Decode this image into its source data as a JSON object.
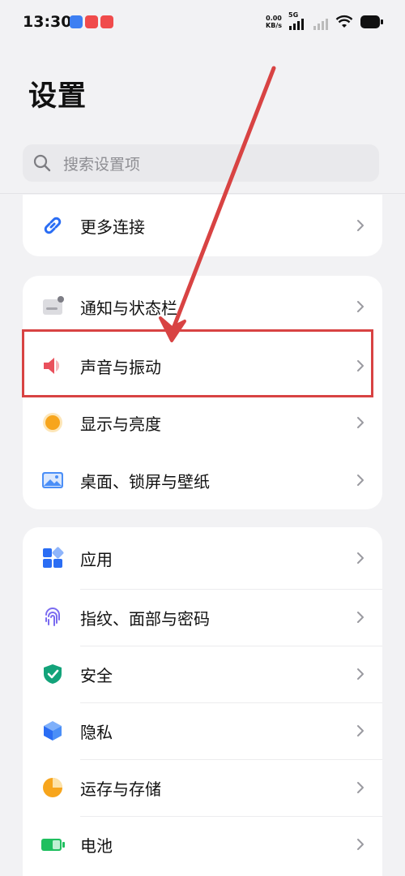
{
  "status_bar": {
    "time": "13:30",
    "net_speed_value": "0.00",
    "net_speed_unit": "KB/s",
    "network_type": "5G",
    "app_badge_colors": [
      "#3d7ff2",
      "#f04b4b",
      "#f04b4b"
    ]
  },
  "page": {
    "title": "设置"
  },
  "search": {
    "placeholder": "搜索设置项"
  },
  "group_top": {
    "items": [
      {
        "label": "更多连接",
        "icon": "link-icon"
      }
    ]
  },
  "group_display": {
    "items": [
      {
        "label": "通知与状态栏",
        "icon": "notification-icon"
      },
      {
        "label": "声音与振动",
        "icon": "speaker-icon"
      },
      {
        "label": "显示与亮度",
        "icon": "brightness-icon"
      },
      {
        "label": "桌面、锁屏与壁纸",
        "icon": "wallpaper-icon"
      }
    ]
  },
  "group_system": {
    "items": [
      {
        "label": "应用",
        "icon": "apps-icon"
      },
      {
        "label": "指纹、面部与密码",
        "icon": "fingerprint-icon"
      },
      {
        "label": "安全",
        "icon": "shield-icon"
      },
      {
        "label": "隐私",
        "icon": "privacy-cube-icon"
      },
      {
        "label": "运存与存储",
        "icon": "storage-pie-icon"
      },
      {
        "label": "电池",
        "icon": "battery-icon"
      }
    ]
  },
  "colors": {
    "link": "#2a6df4",
    "annotation_red": "#d84343",
    "brightness": "#f7a51c",
    "shield": "#13a37a",
    "battery": "#1fbf5f"
  }
}
